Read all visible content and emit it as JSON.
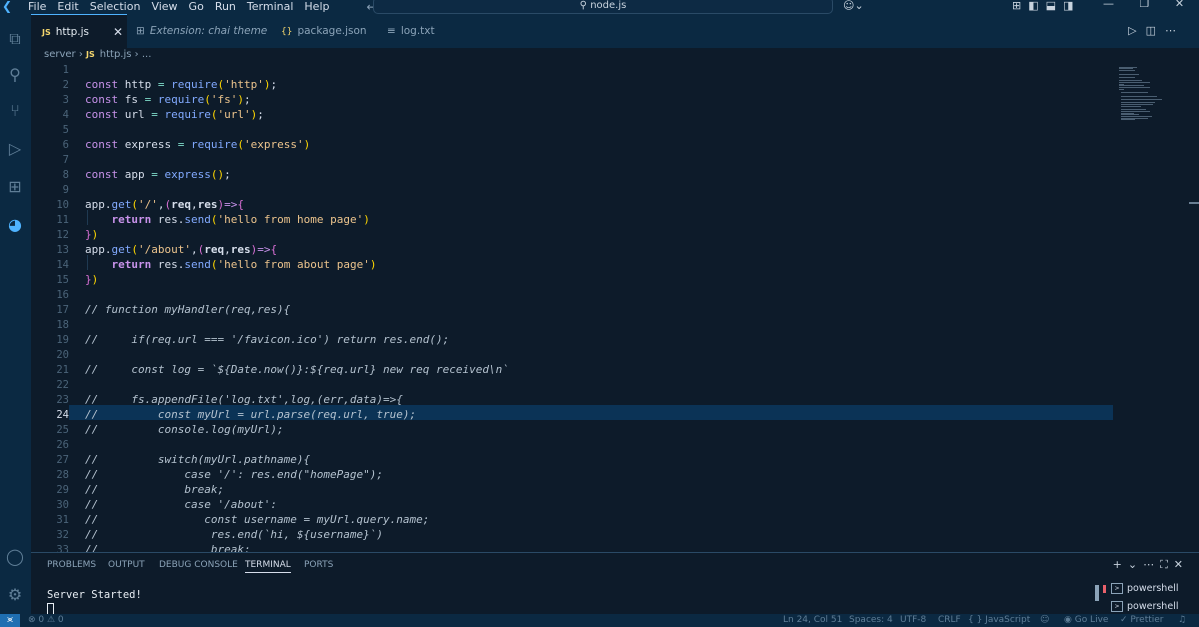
{
  "menu": [
    "File",
    "Edit",
    "Selection",
    "View",
    "Go",
    "Run",
    "Terminal",
    "Help"
  ],
  "command_center": "node.js",
  "tabs": [
    {
      "label": "http.js",
      "badge": "JS",
      "active": true
    },
    {
      "label": "Extension: chai theme",
      "badge": "⊞",
      "active": false
    },
    {
      "label": "package.json",
      "badge": "{}",
      "active": false
    },
    {
      "label": "log.txt",
      "badge": "≡",
      "active": false
    }
  ],
  "breadcrumb": {
    "folder": "server",
    "badge": "JS",
    "file": "http.js",
    "more": "..."
  },
  "cursor_line": 24,
  "line_numbers": [
    "1",
    "2",
    "3",
    "4",
    "5",
    "6",
    "7",
    "8",
    "9",
    "10",
    "11",
    "12",
    "13",
    "14",
    "15",
    "16",
    "17",
    "18",
    "19",
    "20",
    "21",
    "22",
    "23",
    "24",
    "25",
    "26",
    "27",
    "28",
    "29",
    "30",
    "31",
    "32",
    "33"
  ],
  "comment_lines": {
    "l17": "// function myHandler(req,res){",
    "l19": "//     if(req.url === '/favicon.ico') return res.end();",
    "l21": "//     const log = `${Date.now()}:${req.url} new req received\\n`",
    "l23": "//     fs.appendFile('log.txt',log,(err,data)=>{",
    "l24": "//         const myUrl = url.parse(req.url, true);",
    "l25": "//         console.log(myUrl);",
    "l27": "//         switch(myUrl.pathname){",
    "l28": "//             case '/': res.end(\"homePage\");",
    "l29": "//             break;",
    "l30": "//             case '/about':",
    "l31": "//                const username = myUrl.query.name;",
    "l32": "//                 res.end(`hi, ${username}`)",
    "l33": "//                 break;"
  },
  "code": {
    "const_kw": "const",
    "http": "http",
    "fs": "fs",
    "url": "url",
    "express": "express",
    "app": "app",
    "require": "require",
    "eq": "=",
    "str_http": "'http'",
    "str_fs": "'fs'",
    "str_url": "'url'",
    "str_express": "'express'",
    "get": "get",
    "route_home": "'/'",
    "route_about": "'/about'",
    "req": "req",
    "res": "res",
    "arrow": "=>",
    "return_kw": "return",
    "send": "send",
    "msg_home": "'hello from home page'",
    "msg_about": "'hello from about page'"
  },
  "panel": {
    "tabs": [
      "PROBLEMS",
      "OUTPUT",
      "DEBUG CONSOLE",
      "TERMINAL",
      "PORTS"
    ],
    "active_tab": "TERMINAL",
    "terminal_output": "Server Started!",
    "terminals": [
      "powershell",
      "powershell"
    ]
  },
  "status": {
    "problems": "⊗ 0 ⚠ 0",
    "position": "Ln 24, Col 51",
    "spaces": "Spaces: 4",
    "encoding": "UTF-8",
    "eol": "CRLF",
    "language": "{ } JavaScript",
    "golive": "Go Live",
    "prettier": "✓ Prettier"
  }
}
